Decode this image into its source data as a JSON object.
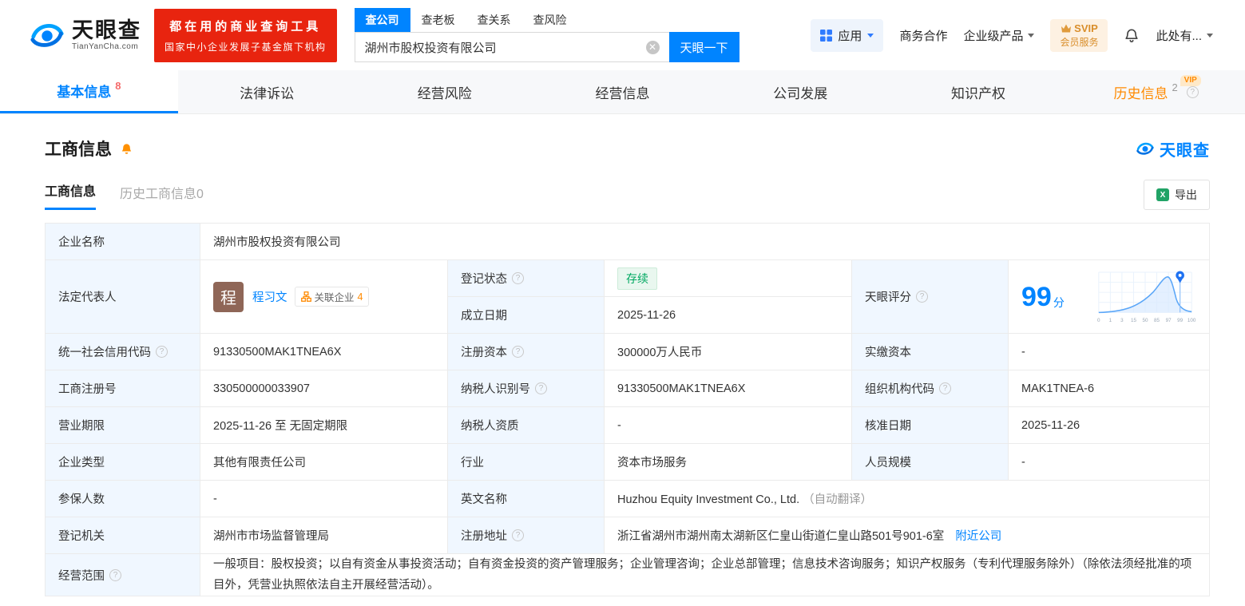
{
  "palette": {
    "brand_blue": "#0084ff",
    "banner_red": "#e8240f",
    "status_green": "#00a860",
    "vip_orange": "#ff8a00",
    "label_bg": "#f0f7ff"
  },
  "header": {
    "logo_cn": "天眼查",
    "logo_en": "TianYanCha.com",
    "banner_line1": "都在用的商业查询工具",
    "banner_line2": "国家中小企业发展子基金旗下机构",
    "search_tabs": [
      {
        "label": "查公司"
      },
      {
        "label": "查老板"
      },
      {
        "label": "查关系"
      },
      {
        "label": "查风险"
      }
    ],
    "search_value": "湖州市股权投资有限公司",
    "clear_glyph": "✕",
    "search_button": "天眼一下",
    "apps_label": "应用",
    "link_cooperation": "商务合作",
    "link_enterprise": "企业级产品",
    "svip_line1": "SVIP",
    "svip_line2": "会员服务",
    "more_label": "此处有..."
  },
  "nav_tabs": [
    {
      "label": "基本信息",
      "count": "8"
    },
    {
      "label": "法律诉讼"
    },
    {
      "label": "经营风险"
    },
    {
      "label": "经营信息"
    },
    {
      "label": "公司发展"
    },
    {
      "label": "知识产权"
    },
    {
      "label": "历史信息",
      "count": "2",
      "vip": "VIP"
    }
  ],
  "section": {
    "title": "工商信息",
    "watermark": "天眼查",
    "subtab_active": "工商信息",
    "subtab_history": "历史工商信息0",
    "export_label": "导出",
    "excel_glyph": "X"
  },
  "fields": {
    "company_name": {
      "label": "企业名称",
      "value": "湖州市股权投资有限公司"
    },
    "legal_rep": {
      "label": "法定代表人",
      "avatar": "程",
      "name": "程习文",
      "related_label": "关联企业",
      "related_count": "4"
    },
    "reg_status": {
      "label": "登记状态",
      "value": "存续"
    },
    "establish_date": {
      "label": "成立日期",
      "value": "2025-11-26"
    },
    "score": {
      "label": "天眼评分",
      "value": "99",
      "unit": "分",
      "ticks": [
        "0",
        "1",
        "3",
        "15",
        "50",
        "85",
        "97",
        "99",
        "100"
      ]
    },
    "credit_code": {
      "label": "统一社会信用代码",
      "value": "91330500MAK1TNEA6X"
    },
    "reg_capital": {
      "label": "注册资本",
      "value": "300000万人民币"
    },
    "paid_capital": {
      "label": "实缴资本",
      "value": "-"
    },
    "reg_number": {
      "label": "工商注册号",
      "value": "330500000033907"
    },
    "taxpayer_id": {
      "label": "纳税人识别号",
      "value": "91330500MAK1TNEA6X"
    },
    "org_code": {
      "label": "组织机构代码",
      "value": "MAK1TNEA-6"
    },
    "business_term": {
      "label": "营业期限",
      "value": "2025-11-26 至 无固定期限"
    },
    "taxpayer_quality": {
      "label": "纳税人资质",
      "value": "-"
    },
    "approval_date": {
      "label": "核准日期",
      "value": "2025-11-26"
    },
    "company_type": {
      "label": "企业类型",
      "value": "其他有限责任公司"
    },
    "industry": {
      "label": "行业",
      "value": "资本市场服务"
    },
    "staff_size": {
      "label": "人员规模",
      "value": "-"
    },
    "insured_count": {
      "label": "参保人数",
      "value": "-"
    },
    "english_name": {
      "label": "英文名称",
      "value": "Huzhou Equity Investment Co., Ltd.",
      "note": "（自动翻译）"
    },
    "reg_authority": {
      "label": "登记机关",
      "value": "湖州市市场监督管理局"
    },
    "reg_address": {
      "label": "注册地址",
      "value": "浙江省湖州市湖州南太湖新区仁皇山街道仁皇山路501号901-6室",
      "nearby": "附近公司"
    },
    "business_scope": {
      "label": "经营范围",
      "value": "一般项目：股权投资；以自有资金从事投资活动；自有资金投资的资产管理服务；企业管理咨询；企业总部管理；信息技术咨询服务；知识产权服务（专利代理服务除外）（除依法须经批准的项目外，凭营业执照依法自主开展经营活动）。"
    }
  }
}
